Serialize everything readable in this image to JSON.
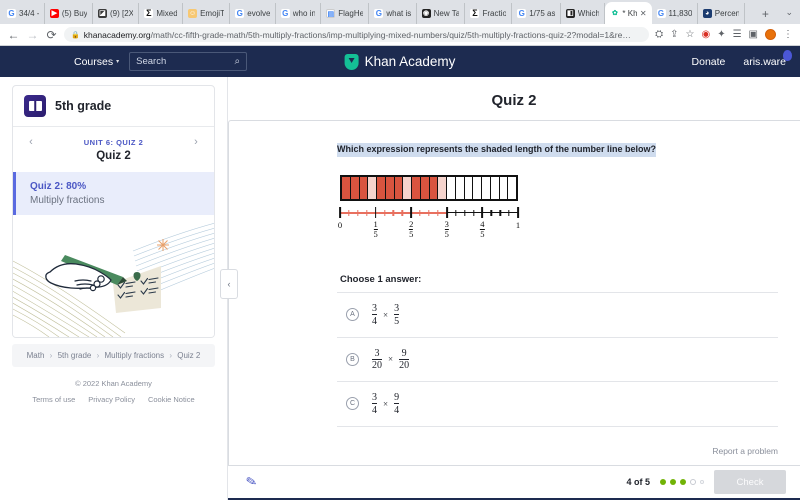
{
  "browser": {
    "tabs": [
      {
        "label": "34/4 - ",
        "favicon": "google-icon",
        "active": false
      },
      {
        "label": "(5) Buy",
        "favicon": "youtube-icon",
        "active": false
      },
      {
        "label": "(9) [2X",
        "favicon": "dark-icon",
        "active": false
      },
      {
        "label": "Mixed",
        "favicon": "sigma-icon",
        "active": false
      },
      {
        "label": "EmojiT",
        "favicon": "emoji-icon",
        "active": false
      },
      {
        "label": "evolve",
        "favicon": "google-icon",
        "active": false
      },
      {
        "label": "who in",
        "favicon": "google-icon",
        "active": false
      },
      {
        "label": "FlagHe",
        "favicon": "doc-icon",
        "active": false
      },
      {
        "label": "what is",
        "favicon": "google-icon",
        "active": false
      },
      {
        "label": "New Ta",
        "favicon": "globe-icon",
        "active": false
      },
      {
        "label": "Fractio",
        "favicon": "sigma-icon",
        "active": false
      },
      {
        "label": "1/75 as",
        "favicon": "google-icon",
        "active": false
      },
      {
        "label": "Which",
        "favicon": "black-icon",
        "active": false
      },
      {
        "label": "* Kh",
        "favicon": "khan-icon",
        "active": true
      },
      {
        "label": "11,830",
        "favicon": "google-icon",
        "active": false
      },
      {
        "label": "Percen",
        "favicon": "blue-icon",
        "active": false
      }
    ],
    "new_tab_label": "+",
    "tab_list_chevron": "⌄",
    "back_icon": "←",
    "forward_icon": "→",
    "reload_icon": "⟳",
    "lock_icon": "🔒",
    "url_host": "khanacademy.org",
    "url_path": "/math/cc-fifth-grade-math/5th-multiply-fractions/imp-multiplying-mixed-numbers/quiz/5th-multiply-fractions-quiz-2?modal=1&re…",
    "extension_icons": [
      "tracker-icon",
      "share-icon",
      "star-icon",
      "puzzle-red-icon",
      "extensions-icon",
      "reading-list-icon",
      "sidepanel-icon"
    ],
    "profile_avatar": "user-avatar",
    "menu_icon": "⋮"
  },
  "ka_header": {
    "courses_label": "Courses",
    "courses_caret": "▾",
    "search_placeholder": "Search",
    "search_icon": "⌕",
    "brand": "Khan Academy",
    "donate_label": "Donate",
    "user_name": "aris.ware"
  },
  "sidebar": {
    "grade_title": "5th grade",
    "prev_arrow": "‹",
    "next_arrow": "›",
    "unit_label": "UNIT 6: QUIZ 2",
    "quiz_heading": "Quiz 2",
    "quiz_item_title": "Quiz 2: 80%",
    "quiz_item_subtitle": "Multiply fractions",
    "breadcrumb": [
      "Math",
      "5th grade",
      "Multiply fractions",
      "Quiz 2"
    ],
    "breadcrumb_separator": "›",
    "copyright": "© 2022 Khan Academy",
    "legal_links": [
      "Terms of use",
      "Privacy Policy",
      "Cookie Notice"
    ]
  },
  "main": {
    "quiz_title": "Quiz 2",
    "question_prompt": "Which expression represents the shaded length of the number line below?",
    "choose_label": "Choose 1 answer:",
    "choices": [
      {
        "letter": "A",
        "left_num": "3",
        "left_den": "4",
        "operator": "×",
        "right_num": "3",
        "right_den": "5"
      },
      {
        "letter": "B",
        "left_num": "3",
        "left_den": "20",
        "operator": "×",
        "right_num": "9",
        "right_den": "20"
      },
      {
        "letter": "C",
        "left_num": "3",
        "left_den": "4",
        "operator": "×",
        "right_num": "9",
        "right_den": "4"
      }
    ],
    "report_label": "Report a problem",
    "collapse_arrow": "‹"
  },
  "numberline": {
    "total_cells": 20,
    "shaded_cells": 12,
    "cell_colors": [
      "#d9543f",
      "#d9543f",
      "#d9543f",
      "#f6d4cd",
      "#d9543f",
      "#d9543f",
      "#d9543f",
      "#f6d4cd",
      "#d9543f",
      "#d9543f",
      "#d9543f",
      "#f6d4cd",
      "#ffffff",
      "#ffffff",
      "#ffffff",
      "#ffffff",
      "#ffffff",
      "#ffffff",
      "#ffffff",
      "#ffffff"
    ],
    "tick_labels": [
      "0",
      "1/5",
      "2/5",
      "3/5",
      "4/5",
      "1"
    ],
    "major_ticks": [
      0,
      0.2,
      0.4,
      0.6,
      0.8,
      1.0
    ],
    "highlight_start": 0.0,
    "highlight_end": 0.6,
    "highlight_color": "#e8705f",
    "shade_color": "#d9543f",
    "light_shade_color": "#f6d4cd"
  },
  "bottombar": {
    "pencil_icon": "✎",
    "progress_text": "4 of 5",
    "dot_states": [
      "correct",
      "correct",
      "correct",
      "current",
      "pending"
    ],
    "check_label": "Check"
  },
  "colors": {
    "ka_navy": "#1d2b50",
    "ka_green": "#14bf96",
    "accent_blue": "#4b57c4",
    "progress_green": "#71b307"
  }
}
